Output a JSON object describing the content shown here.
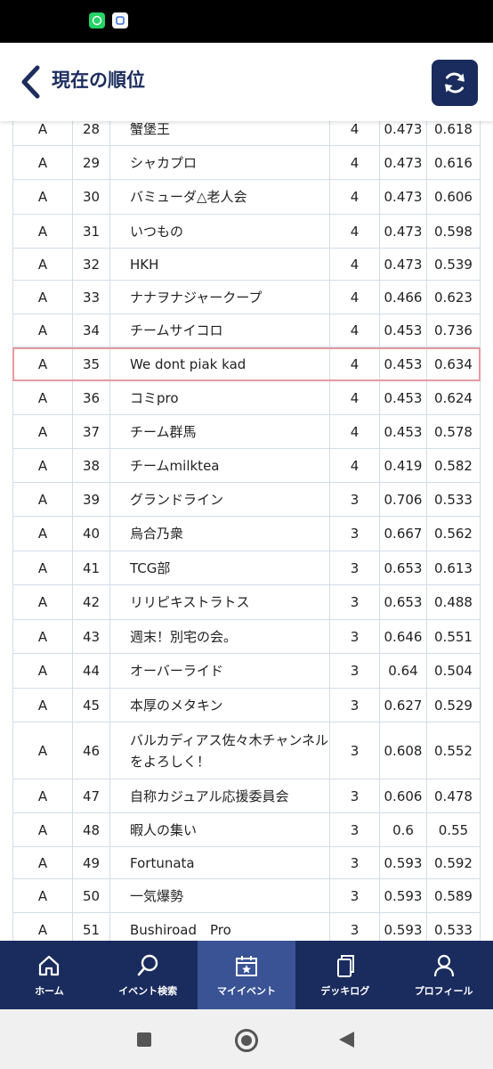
{
  "header": {
    "title": "現在の順位"
  },
  "table": {
    "rows": [
      {
        "div": "A",
        "rank": "28",
        "name": "蟹堡王",
        "wins": "4",
        "omw": "0.473",
        "oomw": "0.618"
      },
      {
        "div": "A",
        "rank": "29",
        "name": "シャカプロ",
        "wins": "4",
        "omw": "0.473",
        "oomw": "0.616"
      },
      {
        "div": "A",
        "rank": "30",
        "name": "バミューダ△老人会",
        "wins": "4",
        "omw": "0.473",
        "oomw": "0.606"
      },
      {
        "div": "A",
        "rank": "31",
        "name": "いつもの",
        "wins": "4",
        "omw": "0.473",
        "oomw": "0.598"
      },
      {
        "div": "A",
        "rank": "32",
        "name": "HKH",
        "wins": "4",
        "omw": "0.473",
        "oomw": "0.539"
      },
      {
        "div": "A",
        "rank": "33",
        "name": "ナナヲナジャークープ",
        "wins": "4",
        "omw": "0.466",
        "oomw": "0.623"
      },
      {
        "div": "A",
        "rank": "34",
        "name": "チームサイコロ",
        "wins": "4",
        "omw": "0.453",
        "oomw": "0.736"
      },
      {
        "div": "A",
        "rank": "35",
        "name": "We dont piak kad",
        "wins": "4",
        "omw": "0.453",
        "oomw": "0.634",
        "highlight": true
      },
      {
        "div": "A",
        "rank": "36",
        "name": "コミpro",
        "wins": "4",
        "omw": "0.453",
        "oomw": "0.624"
      },
      {
        "div": "A",
        "rank": "37",
        "name": "チーム群馬",
        "wins": "4",
        "omw": "0.453",
        "oomw": "0.578"
      },
      {
        "div": "A",
        "rank": "38",
        "name": "チームmilktea",
        "wins": "4",
        "omw": "0.419",
        "oomw": "0.582"
      },
      {
        "div": "A",
        "rank": "39",
        "name": "グランドライン",
        "wins": "3",
        "omw": "0.706",
        "oomw": "0.533"
      },
      {
        "div": "A",
        "rank": "40",
        "name": "烏合乃衆",
        "wins": "3",
        "omw": "0.667",
        "oomw": "0.562"
      },
      {
        "div": "A",
        "rank": "41",
        "name": "TCG部",
        "wins": "3",
        "omw": "0.653",
        "oomw": "0.613"
      },
      {
        "div": "A",
        "rank": "42",
        "name": "リリピキストラトス",
        "wins": "3",
        "omw": "0.653",
        "oomw": "0.488"
      },
      {
        "div": "A",
        "rank": "43",
        "name": "週末！別宅の会。",
        "wins": "3",
        "omw": "0.646",
        "oomw": "0.551"
      },
      {
        "div": "A",
        "rank": "44",
        "name": "オーバーライド",
        "wins": "3",
        "omw": "0.64",
        "oomw": "0.504"
      },
      {
        "div": "A",
        "rank": "45",
        "name": "本厚のメタキン",
        "wins": "3",
        "omw": "0.627",
        "oomw": "0.529"
      },
      {
        "div": "A",
        "rank": "46",
        "name": "バルカディアス佐々木チャンネルをよろしく！",
        "wins": "3",
        "omw": "0.608",
        "oomw": "0.552",
        "tall": true
      },
      {
        "div": "A",
        "rank": "47",
        "name": "自称カジュアル応援委員会",
        "wins": "3",
        "omw": "0.606",
        "oomw": "0.478"
      },
      {
        "div": "A",
        "rank": "48",
        "name": "暇人の集い",
        "wins": "3",
        "omw": "0.6",
        "oomw": "0.55"
      },
      {
        "div": "A",
        "rank": "49",
        "name": "Fortunata",
        "wins": "3",
        "omw": "0.593",
        "oomw": "0.592"
      },
      {
        "div": "A",
        "rank": "50",
        "name": "一気爆勢",
        "wins": "3",
        "omw": "0.593",
        "oomw": "0.589"
      },
      {
        "div": "A",
        "rank": "51",
        "name": "Bushiroad　Pro",
        "wins": "3",
        "omw": "0.593",
        "oomw": "0.533"
      }
    ]
  },
  "nav": {
    "items": [
      {
        "label": "ホーム",
        "icon": "home-icon"
      },
      {
        "label": "イベント検索",
        "icon": "search-icon"
      },
      {
        "label": "マイイベント",
        "icon": "calendar-star-icon",
        "active": true
      },
      {
        "label": "デッキログ",
        "icon": "cards-icon"
      },
      {
        "label": "プロフィール",
        "icon": "user-icon"
      }
    ]
  },
  "colors": {
    "header_text": "#1c2d5e",
    "nav_bg": "#1a2b5e",
    "nav_active": "#3a5395",
    "highlight_border": "#e79aa0"
  }
}
